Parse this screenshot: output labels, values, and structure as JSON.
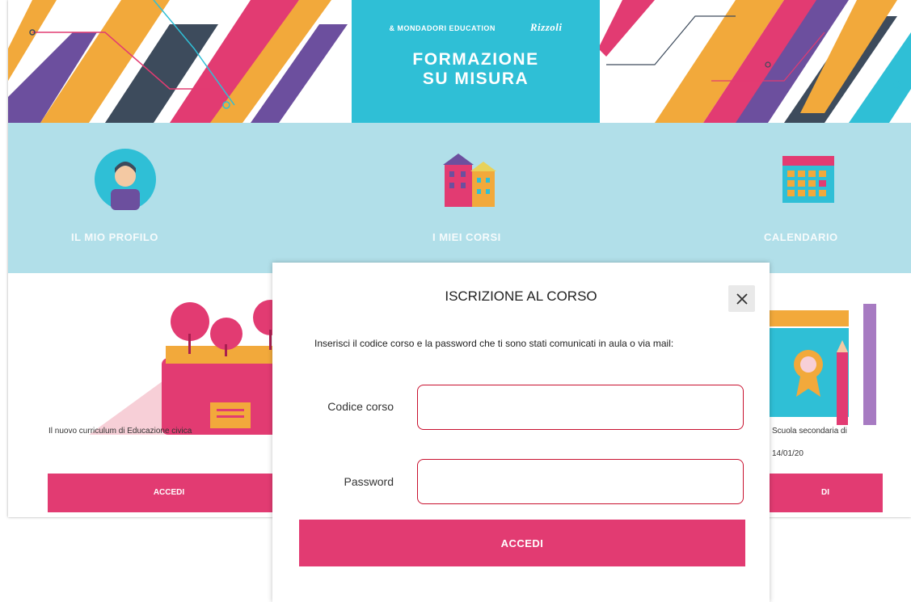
{
  "banner": {
    "logo_left": "& MONDADORI EDUCATION",
    "logo_right": "Rizzoli",
    "title_line1": "FORMAZIONE",
    "title_line2": "SU MISURA"
  },
  "nav": {
    "items": [
      {
        "label": "IL MIO PROFILO",
        "icon": "profile-icon"
      },
      {
        "label": "I MIEI CORSI",
        "icon": "school-building-icon"
      },
      {
        "label": "CALENDARIO",
        "icon": "calendar-icon"
      }
    ]
  },
  "cards": [
    {
      "title": "Il nuovo curriculum di Educazione civica",
      "date": "",
      "button": "ACCEDI"
    },
    {
      "title": "Scuola secondaria di",
      "date": "14/01/20",
      "button": "DI"
    }
  ],
  "modal": {
    "title": "ISCRIZIONE AL CORSO",
    "instructions": "Inserisci il codice corso e la password che ti sono stati comunicati in aula o via mail:",
    "code_label": "Codice corso",
    "code_value": "",
    "password_label": "Password",
    "password_value": "",
    "submit_label": "ACCEDI",
    "close_icon": "close-icon"
  },
  "colors": {
    "accent": "#e23b72",
    "nav_bg": "#b1dfe9",
    "brand_bg": "#2fbfd6",
    "input_border": "#c8102e"
  }
}
